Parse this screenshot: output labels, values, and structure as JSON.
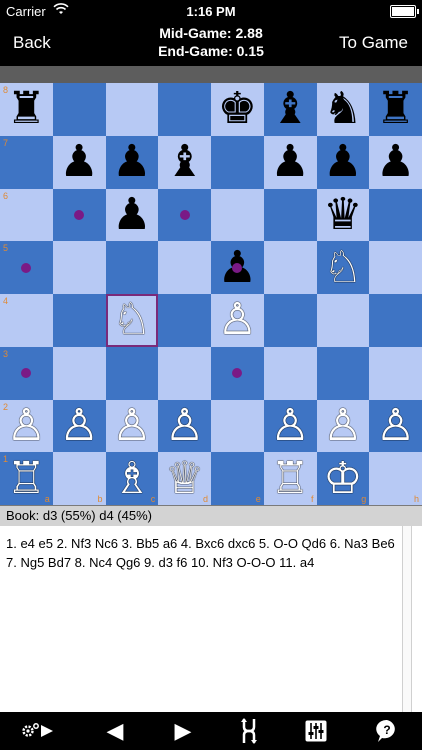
{
  "status": {
    "carrier": "Carrier",
    "time": "1:16 PM"
  },
  "nav": {
    "back": "Back",
    "mid_game": "Mid-Game: 2.88",
    "end_game": "End-Game: 0.15",
    "to_game": "To Game"
  },
  "board": {
    "ranks": [
      "8",
      "7",
      "6",
      "5",
      "4",
      "3",
      "2",
      "1"
    ],
    "files": [
      "a",
      "b",
      "c",
      "d",
      "e",
      "f",
      "g",
      "h"
    ],
    "pieces": [
      [
        "♜",
        "",
        "",
        "",
        "♚",
        "♝",
        "♞",
        "♜"
      ],
      [
        "",
        "♟",
        "♟",
        "♝",
        "",
        "♟",
        "♟",
        "♟"
      ],
      [
        "",
        "",
        "♟",
        "",
        "",
        "",
        "♛",
        ""
      ],
      [
        "",
        "",
        "",
        "",
        "♟",
        "",
        "♘",
        ""
      ],
      [
        "",
        "",
        "♘",
        "",
        "♙",
        "",
        "",
        ""
      ],
      [
        "",
        "",
        "",
        "",
        "",
        "",
        "",
        ""
      ],
      [
        "♙",
        "♙",
        "♙",
        "♙",
        "",
        "♙",
        "♙",
        "♙"
      ],
      [
        "♖",
        "",
        "♗",
        "♕",
        "",
        "♖",
        "♔",
        ""
      ]
    ],
    "selected": "c4",
    "dots": [
      "b6",
      "d6",
      "a5",
      "e5",
      "a3",
      "e3"
    ],
    "colors": {
      "light": "#b7c9f4",
      "dark": "#3e74c4",
      "highlight": "#7a2a7a",
      "dot": "#7a1a86",
      "coord": "#e08a35"
    }
  },
  "book": "Book: d3 (55%) d4 (45%)",
  "moves": "1. e4 e5 2. Nf3 Nc6 3. Bb5 a6 4. Bxc6 dxc6 5. O-O Qd6 6. Na3 Be6 7. Ng5 Bd7 8. Nc4 Qg6 9. d3 f6 10. Nf3 O-O-O 11. a4",
  "toolbar": {
    "settings_icon": "gear-play-icon",
    "prev_icon": "◀",
    "next_icon": "▶",
    "flip_icon": "flip-board-icon",
    "mixer_icon": "sliders-icon",
    "help_icon": "?"
  }
}
